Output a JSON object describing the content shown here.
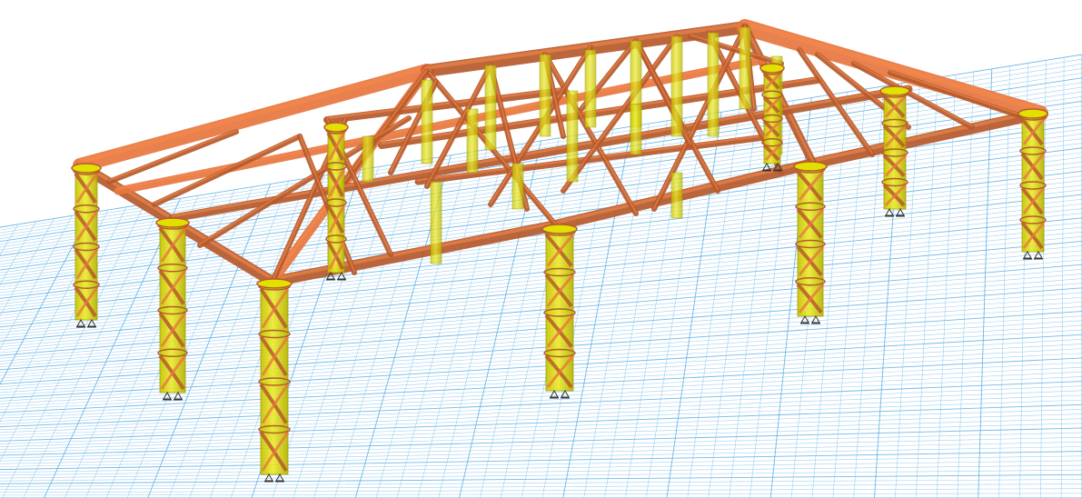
{
  "viewport": {
    "background": "#ffffff",
    "grid_color": "#8fc8ec",
    "grid_color_strong": "#5aaee2"
  },
  "model": {
    "beam_color": "#e8773f",
    "beam_color_dark": "#b65a2c",
    "beam_color_light": "#f58a4c",
    "column_color": "#e2e000",
    "column_color_dark": "#b4b000",
    "column_stroke": "#9a9600",
    "support_color": "#333333",
    "icons": [
      "pinned-support-icon"
    ]
  }
}
